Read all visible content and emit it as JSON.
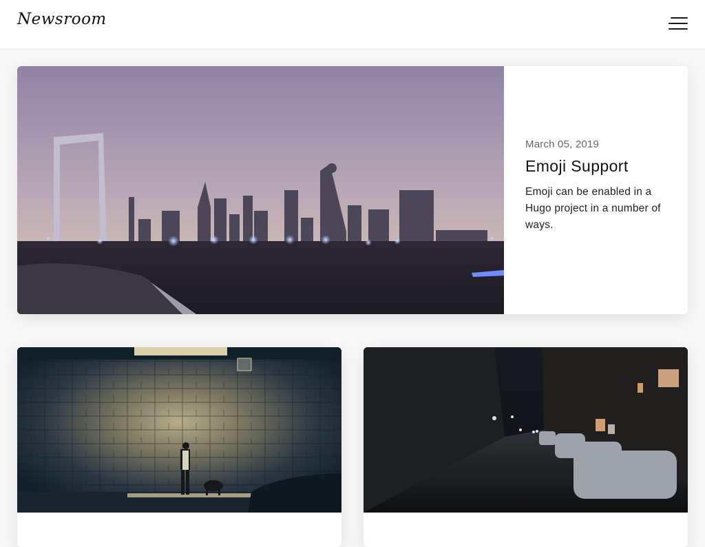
{
  "header": {
    "logo": "Newsroom",
    "menu_icon": "hamburger-menu-icon"
  },
  "featured": {
    "date": "March 05, 2019",
    "title": "Emoji Support",
    "summary": "Emoji can be enabled in a Hugo project in a number of ways."
  },
  "posts": [
    {},
    {}
  ],
  "colors": {
    "background": "#f8f8f8",
    "card": "#ffffff",
    "text": "#222222",
    "muted": "#666666"
  }
}
